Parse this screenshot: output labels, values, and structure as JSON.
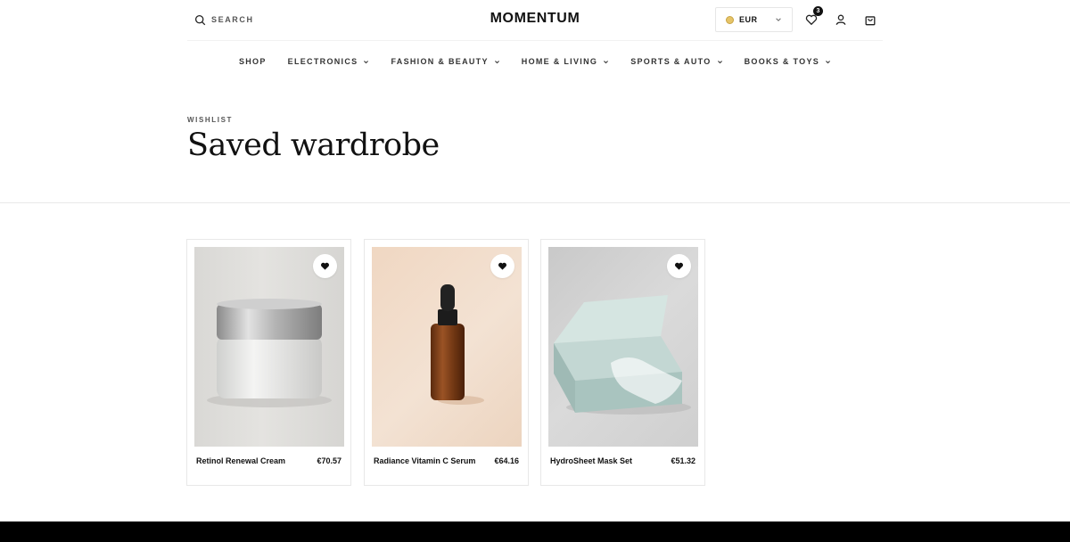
{
  "header": {
    "search_label": "SEARCH",
    "logo": "MOMENTUM",
    "currency": "EUR",
    "wishlist_count": "3"
  },
  "nav": {
    "items": [
      {
        "label": "SHOP",
        "has_dropdown": false
      },
      {
        "label": "ELECTRONICS",
        "has_dropdown": true
      },
      {
        "label": "FASHION & BEAUTY",
        "has_dropdown": true
      },
      {
        "label": "HOME & LIVING",
        "has_dropdown": true
      },
      {
        "label": "SPORTS & AUTO",
        "has_dropdown": true
      },
      {
        "label": "BOOKS & TOYS",
        "has_dropdown": true
      }
    ]
  },
  "page": {
    "eyebrow": "WISHLIST",
    "title": "Saved wardrobe"
  },
  "products": [
    {
      "name": "Retinol Renewal Cream",
      "price": "€70.57",
      "image": "cream-jar"
    },
    {
      "name": "Radiance Vitamin C Serum",
      "price": "€64.16",
      "image": "serum-bottle"
    },
    {
      "name": "HydroSheet Mask Set",
      "price": "€51.32",
      "image": "mask-box"
    }
  ],
  "colors": {
    "accent": "#111111",
    "footer": "#000000",
    "coin": "#e6c468"
  }
}
